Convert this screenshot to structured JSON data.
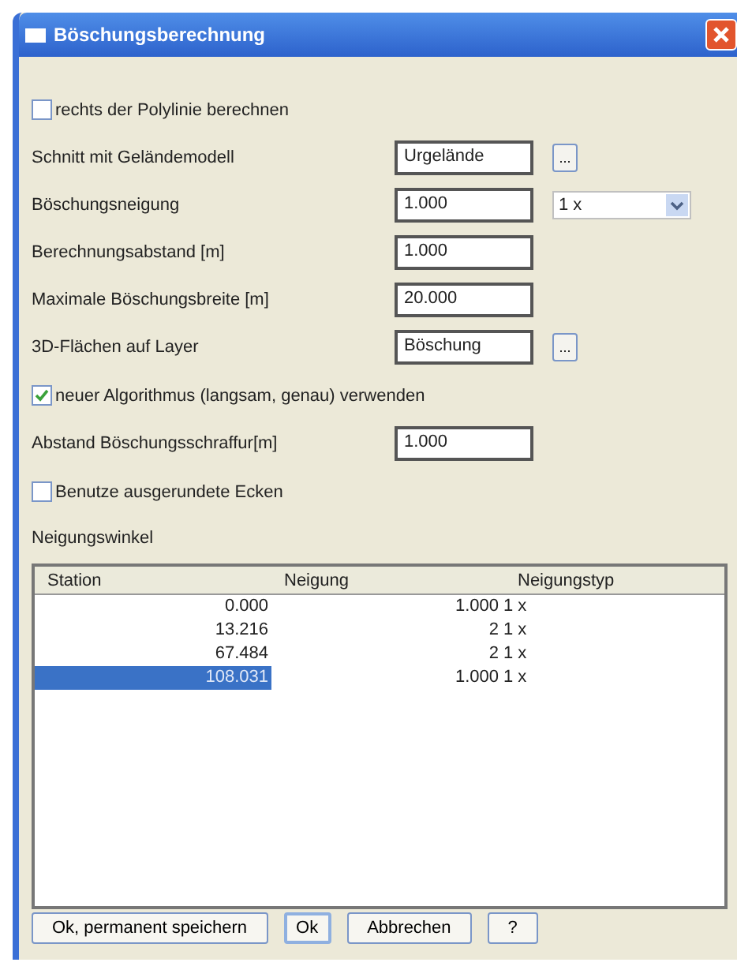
{
  "window": {
    "title": "Böschungsberechnung"
  },
  "options": [
    {
      "kind": "checkbox",
      "label": "rechts der Polylinie berechnen",
      "checked": false
    },
    {
      "kind": "field",
      "label": "Schnitt mit Geländemodell",
      "value": "Urgelände",
      "browse": "..."
    },
    {
      "kind": "combo",
      "label": "Böschungsneigung",
      "value": "1.000",
      "combo": "1 x"
    },
    {
      "kind": "field",
      "label": "Berechnungsabstand [m]",
      "value": "1.000"
    },
    {
      "kind": "field",
      "label": "Maximale Böschungsbreite [m]",
      "value": "20.000"
    },
    {
      "kind": "field",
      "label": "3D-Flächen auf Layer",
      "value": "Böschung",
      "browse": "..."
    },
    {
      "kind": "checkbox",
      "label": "neuer Algorithmus (langsam, genau) verwenden",
      "checked": true
    },
    {
      "kind": "field",
      "label": "Abstand Böschungsschraffur[m]",
      "value": "1.000"
    },
    {
      "kind": "checkbox",
      "label": "Benutze ausgerundete Ecken",
      "checked": false
    }
  ],
  "table": {
    "title": "Neigungswinkel",
    "columns": [
      "Station",
      "Neigung",
      "Neigungstyp"
    ],
    "rows": [
      {
        "cells": [
          "0.000",
          "1.000",
          "1 x"
        ],
        "selected": false
      },
      {
        "cells": [
          "13.216",
          "2",
          "1 x"
        ],
        "selected": false
      },
      {
        "cells": [
          "67.484",
          "2",
          "1 x"
        ],
        "selected": false
      },
      {
        "cells": [
          "108.031",
          "1.000",
          "1 x"
        ],
        "selected": true
      }
    ]
  },
  "buttons": [
    "Ok, permanent speichern",
    "Ok",
    "Abbrechen",
    "?"
  ]
}
